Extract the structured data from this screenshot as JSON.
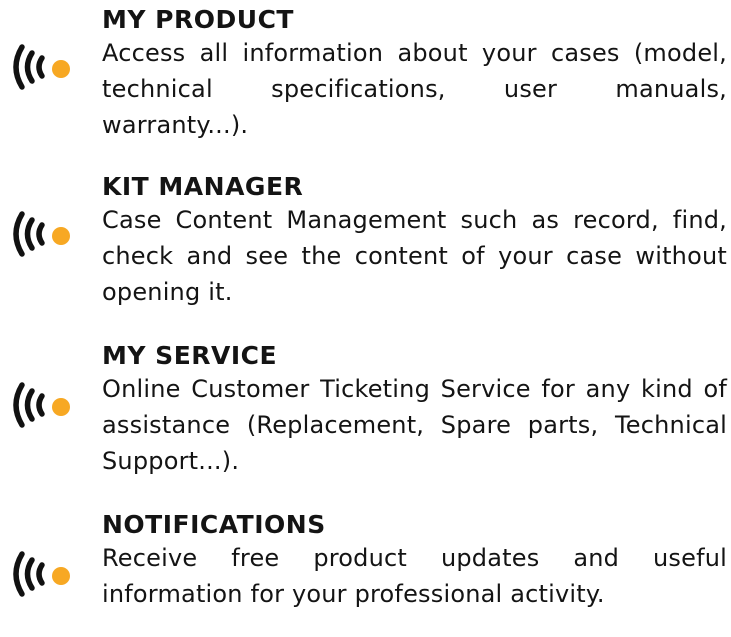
{
  "colors": {
    "accent": "#F7A823",
    "text": "#141414"
  },
  "features": [
    {
      "icon": "wireless-signal-icon",
      "title": "MY PRODUCT",
      "description": "Access all information about your cases (model, technical specifications, user manuals, warranty...)."
    },
    {
      "icon": "wireless-signal-icon",
      "title": "KIT MANAGER",
      "description": "Case Content Management such as record, find, check and see the content of your case without opening it."
    },
    {
      "icon": "wireless-signal-icon",
      "title": "MY SERVICE",
      "description": "Online Customer Ticketing Service for any kind of assistance (Replacement, Spare parts, Technical Support...)."
    },
    {
      "icon": "wireless-signal-icon",
      "title": "NOTIFICATIONS",
      "description": "Receive free product updates and useful information for your professional activity."
    }
  ]
}
